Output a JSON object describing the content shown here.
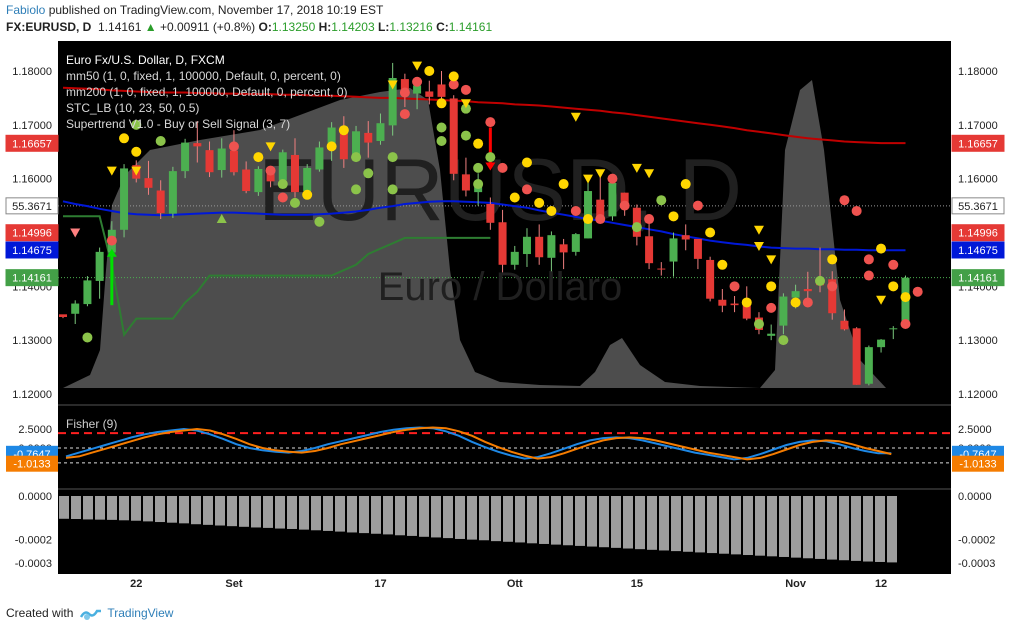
{
  "header": {
    "user": "Fabiolo",
    "published_text": "published on TradingView.com, November 17, 2018 10:19 EST",
    "symbol": "FX:EURUSD, D",
    "last": "1.14161",
    "change": "+0.00911 (+0.8%)",
    "o_label": "O:",
    "o_value": "1.13250",
    "h_label": "H:",
    "h_value": "1.14203",
    "l_label": "L:",
    "l_value": "1.13216",
    "c_label": "C:",
    "c_value": "1.14161"
  },
  "legend": [
    "Euro Fx/U.S. Dollar, D, FXCM",
    "mm50 (1, 0, fixed, 1, 100000, Default, 0, percent, 0)",
    "mm200 (1, 0, fixed, 1, 100000, Default, 0, percent, 0)",
    "STC_LB (10, 23, 50, 0.5)",
    "Supertrend V1.0 - Buy or Sell Signal (3, 7)"
  ],
  "watermark": {
    "symbol": "EURUSD, D",
    "name": "Euro / Dollaro"
  },
  "footer": {
    "created_with": "Created with",
    "brand": "TradingView"
  },
  "colors": {
    "bull": "#4caf50",
    "bear": "#e53935",
    "mm50": "#0018d8",
    "mm200": "#c00000",
    "stc": "#2e7d32",
    "fisher1": "#1e88e5",
    "fisher2": "#f57c00",
    "dot_red": "#ef5350",
    "dot_yellow": "#ffd600",
    "dot_green": "#8bc34a"
  },
  "chart_data": [
    {
      "type": "candlestick",
      "title": "Euro Fx/U.S. Dollar, D, FXCM",
      "ylim": [
        1.118,
        1.1815
      ],
      "y_ticks": [
        "1.18000",
        "1.17000",
        "1.16000",
        "1.15000",
        "1.14000",
        "1.13000",
        "1.12000"
      ],
      "x_ticks": [
        "22",
        "Set",
        "17",
        "Ott",
        "15",
        "Nov",
        "12"
      ],
      "price_tags": [
        {
          "label": "1.16657",
          "value": 1.16657,
          "color": "#e53935"
        },
        {
          "label": "55.3671",
          "value": 1.15495,
          "color": "#ffffff"
        },
        {
          "label": "1.14996",
          "value": 1.14996,
          "color": "#e53935"
        },
        {
          "label": "1.14675",
          "value": 1.14675,
          "color": "#0018d8"
        },
        {
          "label": "1.14161",
          "value": 1.14161,
          "color": "#43a047"
        }
      ],
      "ohlc": [
        [
          1.1348,
          1.1345,
          1.1341,
          1.1343
        ],
        [
          1.1349,
          1.1374,
          1.133,
          1.1368
        ],
        [
          1.1367,
          1.1419,
          1.1363,
          1.1411
        ],
        [
          1.141,
          1.1472,
          1.1377,
          1.1464
        ],
        [
          1.1463,
          1.1521,
          1.1452,
          1.1505
        ],
        [
          1.1505,
          1.1627,
          1.1491,
          1.1619
        ],
        [
          1.1625,
          1.1634,
          1.1593,
          1.16
        ],
        [
          1.1601,
          1.1633,
          1.157,
          1.1583
        ],
        [
          1.1578,
          1.1597,
          1.1525,
          1.1536
        ],
        [
          1.1535,
          1.1622,
          1.1527,
          1.1614
        ],
        [
          1.1614,
          1.1674,
          1.1601,
          1.1667
        ],
        [
          1.1666,
          1.1707,
          1.163,
          1.166
        ],
        [
          1.1653,
          1.1669,
          1.1603,
          1.1612
        ],
        [
          1.1616,
          1.1675,
          1.1602,
          1.1656
        ],
        [
          1.1652,
          1.169,
          1.1606,
          1.1612
        ],
        [
          1.1617,
          1.1632,
          1.1573,
          1.1577
        ],
        [
          1.1575,
          1.1623,
          1.1568,
          1.1618
        ],
        [
          1.1616,
          1.162,
          1.1584,
          1.1595
        ],
        [
          1.1597,
          1.1654,
          1.1592,
          1.1649
        ],
        [
          1.1644,
          1.1675,
          1.1565,
          1.1575
        ],
        [
          1.1577,
          1.1627,
          1.157,
          1.162
        ],
        [
          1.1617,
          1.1669,
          1.1613,
          1.1658
        ],
        [
          1.1658,
          1.1705,
          1.1633,
          1.1695
        ],
        [
          1.1694,
          1.1716,
          1.162,
          1.1636
        ],
        [
          1.1636,
          1.1698,
          1.1632,
          1.1688
        ],
        [
          1.1685,
          1.1707,
          1.1639,
          1.1667
        ],
        [
          1.167,
          1.1721,
          1.1663,
          1.1703
        ],
        [
          1.1699,
          1.1815,
          1.168,
          1.1787
        ],
        [
          1.1785,
          1.1795,
          1.1733,
          1.1756
        ],
        [
          1.1758,
          1.1787,
          1.1729,
          1.1773
        ],
        [
          1.1762,
          1.1782,
          1.1738,
          1.1752
        ],
        [
          1.1775,
          1.18,
          1.174,
          1.1752
        ],
        [
          1.1749,
          1.1755,
          1.1597,
          1.1609
        ],
        [
          1.1608,
          1.1639,
          1.1567,
          1.1578
        ],
        [
          1.1575,
          1.161,
          1.155,
          1.159
        ],
        [
          1.1553,
          1.1565,
          1.1505,
          1.1518
        ],
        [
          1.1519,
          1.1542,
          1.1426,
          1.144
        ],
        [
          1.144,
          1.1475,
          1.1431,
          1.1464
        ],
        [
          1.146,
          1.1508,
          1.1436,
          1.1492
        ],
        [
          1.1492,
          1.1515,
          1.144,
          1.1454
        ],
        [
          1.1453,
          1.1502,
          1.1428,
          1.1495
        ],
        [
          1.1478,
          1.1488,
          1.1432,
          1.1463
        ],
        [
          1.1464,
          1.1499,
          1.1457,
          1.1497
        ],
        [
          1.1489,
          1.1599,
          1.1489,
          1.1577
        ],
        [
          1.1561,
          1.1605,
          1.1532,
          1.153
        ],
        [
          1.153,
          1.1597,
          1.1522,
          1.1592
        ],
        [
          1.1574,
          1.1574,
          1.1531,
          1.1553
        ],
        [
          1.1546,
          1.1552,
          1.1476,
          1.1492
        ],
        [
          1.1493,
          1.1524,
          1.1432,
          1.1443
        ],
        [
          1.1433,
          1.1445,
          1.142,
          1.1432
        ],
        [
          1.1446,
          1.15,
          1.1418,
          1.1489
        ],
        [
          1.1495,
          1.1515,
          1.1467,
          1.1487
        ],
        [
          1.1488,
          1.1488,
          1.1432,
          1.1451
        ],
        [
          1.1449,
          1.1455,
          1.1372,
          1.1377
        ],
        [
          1.1375,
          1.1395,
          1.1352,
          1.1364
        ],
        [
          1.1368,
          1.1382,
          1.1352,
          1.1365
        ],
        [
          1.1376,
          1.14,
          1.1337,
          1.134
        ],
        [
          1.1342,
          1.1352,
          1.1311,
          1.1319
        ],
        [
          1.1308,
          1.1329,
          1.13,
          1.1312
        ],
        [
          1.1327,
          1.1387,
          1.1311,
          1.1381
        ],
        [
          1.1379,
          1.1403,
          1.1359,
          1.1391
        ],
        [
          1.1395,
          1.1427,
          1.137,
          1.1391
        ],
        [
          1.141,
          1.1472,
          1.1389,
          1.1402
        ],
        [
          1.1413,
          1.1428,
          1.1338,
          1.135
        ],
        [
          1.1336,
          1.1357,
          1.1318,
          1.132
        ],
        [
          1.1322,
          1.1324,
          1.1217,
          1.1217
        ],
        [
          1.1219,
          1.129,
          1.1216,
          1.1287
        ],
        [
          1.1287,
          1.1302,
          1.1277,
          1.1301
        ],
        [
          1.1322,
          1.1326,
          1.1302,
          1.1322
        ],
        [
          1.1325,
          1.142,
          1.1322,
          1.1416
        ]
      ],
      "series": [
        {
          "name": "mm50",
          "values": [
            1.1558,
            1.1553,
            1.1549,
            1.1544,
            1.154,
            1.1536,
            1.1534,
            1.1533,
            1.1532,
            1.1533,
            1.1534,
            1.1535,
            1.1536,
            1.1537,
            1.1537,
            1.1536,
            1.1535,
            1.1534,
            1.1533,
            1.1533,
            1.1533,
            1.1534,
            1.1535,
            1.1537,
            1.1539,
            1.1542,
            1.1546,
            1.1549,
            1.1553,
            1.1555,
            1.1557,
            1.1558,
            1.1558,
            1.1557,
            1.1556,
            1.1555,
            1.1552,
            1.1549,
            1.1546,
            1.1541,
            1.1537,
            1.1533,
            1.1529,
            1.1525,
            1.1522,
            1.1518,
            1.1514,
            1.151,
            1.1506,
            1.1502,
            1.1497,
            1.1493,
            1.1489,
            1.1485,
            1.1482,
            1.1479,
            1.1477,
            1.1474,
            1.1472,
            1.1471,
            1.147,
            1.147,
            1.1469,
            1.1469,
            1.1468,
            1.1468,
            1.1467,
            1.1467,
            1.1467,
            1.1467
          ]
        },
        {
          "name": "mm200",
          "values": [
            1.1769,
            1.1768,
            1.1767,
            1.1766,
            1.1764,
            1.1763,
            1.1762,
            1.1761,
            1.176,
            1.176,
            1.176,
            1.1759,
            1.1759,
            1.1758,
            1.1758,
            1.1757,
            1.1757,
            1.1757,
            1.1756,
            1.1756,
            1.1755,
            1.1754,
            1.1754,
            1.1753,
            1.1752,
            1.1751,
            1.175,
            1.175,
            1.1749,
            1.1748,
            1.1747,
            1.1746,
            1.1745,
            1.1744,
            1.1742,
            1.1741,
            1.174,
            1.1738,
            1.1737,
            1.1736,
            1.1734,
            1.1732,
            1.173,
            1.1728,
            1.1726,
            1.1723,
            1.1721,
            1.1718,
            1.1715,
            1.1712,
            1.1709,
            1.1706,
            1.1703,
            1.17,
            1.1697,
            1.1694,
            1.169,
            1.1687,
            1.1684,
            1.1681,
            1.1678,
            1.1675,
            1.1673,
            1.1671,
            1.1669,
            1.1668,
            1.1667,
            1.1666,
            1.1666,
            1.1666
          ]
        },
        {
          "name": "STC_LB",
          "values": [
            1.153,
            1.153,
            1.153,
            1.153,
            1.144,
            1.131,
            1.134,
            1.134,
            1.134,
            1.134,
            1.137,
            1.139,
            1.142,
            1.142,
            1.142,
            1.142,
            1.142,
            1.142,
            1.142,
            1.142,
            1.142,
            1.142,
            1.142,
            1.143,
            1.144,
            1.146,
            1.147,
            1.148,
            1.149,
            1.149,
            1.149,
            1.149,
            1.149,
            1.149,
            1.149,
            1.149
          ]
        }
      ]
    },
    {
      "type": "line",
      "title": "Fisher (9)",
      "ylim": [
        -1.5,
        2.9
      ],
      "y_ticks": [
        "2.5000",
        "0.0000"
      ],
      "last_values": [
        "-0.7647",
        "-1.0133"
      ],
      "series": [
        {
          "name": "Fisher",
          "values": [
            -1.1,
            -0.6,
            -0.1,
            0.4,
            0.9,
            1.4,
            1.8,
            2.1,
            2.3,
            2.5,
            2.3,
            1.8,
            1.2,
            0.5,
            0.0,
            -0.3,
            -0.5,
            -0.6,
            -0.4,
            0.0,
            0.5,
            0.9,
            1.3,
            1.7,
            2.1,
            2.4,
            2.6,
            2.7,
            2.6,
            2.2,
            1.6,
            0.8,
            0.1,
            -0.5,
            -1.0,
            -1.4,
            -1.2,
            -0.7,
            -0.1,
            0.5,
            1.0,
            1.3,
            1.4,
            1.3,
            1.0,
            0.6,
            0.2,
            -0.2,
            -0.6,
            -0.9,
            -1.2,
            -1.5,
            -1.3,
            -0.8,
            -0.2,
            0.4,
            0.8,
            1.0,
            0.9,
            0.5,
            0.0,
            -0.4,
            -0.7,
            -0.7
          ]
        },
        {
          "name": "Trigger",
          "values": [
            -1.3,
            -1.1,
            -0.6,
            -0.1,
            0.4,
            0.9,
            1.4,
            1.8,
            2.1,
            2.3,
            2.5,
            2.3,
            1.8,
            1.2,
            0.5,
            0.0,
            -0.3,
            -0.5,
            -0.6,
            -0.4,
            0.0,
            0.5,
            0.9,
            1.3,
            1.7,
            2.1,
            2.4,
            2.6,
            2.7,
            2.6,
            2.2,
            1.6,
            0.8,
            0.1,
            -0.5,
            -1.0,
            -1.4,
            -1.2,
            -0.7,
            -0.1,
            0.5,
            1.0,
            1.3,
            1.4,
            1.3,
            1.0,
            0.6,
            0.2,
            -0.2,
            -0.6,
            -0.9,
            -1.2,
            -1.5,
            -1.3,
            -0.8,
            -0.2,
            0.4,
            0.8,
            1.0,
            0.9,
            0.5,
            0.0,
            -0.4,
            -0.8
          ]
        }
      ]
    },
    {
      "type": "bar",
      "title": "",
      "ylim": [
        -0.00033,
        0.0
      ],
      "y_ticks": [
        "0.0000",
        "-0.0002",
        "-0.0003"
      ],
      "values": [
        -0.000105,
        -0.000106,
        -0.000108,
        -0.000109,
        -0.00011,
        -0.000112,
        -0.000114,
        -0.000117,
        -0.00012,
        -0.000123,
        -0.000126,
        -0.00013,
        -0.000133,
        -0.000136,
        -0.000139,
        -0.000142,
        -0.000145,
        -0.000147,
        -0.00015,
        -0.000152,
        -0.000155,
        -0.000158,
        -0.000161,
        -0.000164,
        -0.000168,
        -0.000171,
        -0.000174,
        -0.000177,
        -0.000181,
        -0.000184,
        -0.000188,
        -0.000191,
        -0.000194,
        -0.000198,
        -0.000201,
        -0.000204,
        -0.000208,
        -0.000211,
        -0.000214,
        -0.000218,
        -0.000221,
        -0.000224,
        -0.000227,
        -0.00023,
        -0.000233,
        -0.000236,
        -0.000239,
        -0.000242,
        -0.000245,
        -0.000248,
        -0.000251,
        -0.000254,
        -0.000257,
        -0.00026,
        -0.000263,
        -0.000266,
        -0.000269,
        -0.000272,
        -0.000275,
        -0.000278,
        -0.000281,
        -0.000284,
        -0.000287,
        -0.00029,
        -0.000293,
        -0.000296,
        -0.000299,
        -0.000302,
        -0.000304,
        -0.000306
      ]
    }
  ]
}
